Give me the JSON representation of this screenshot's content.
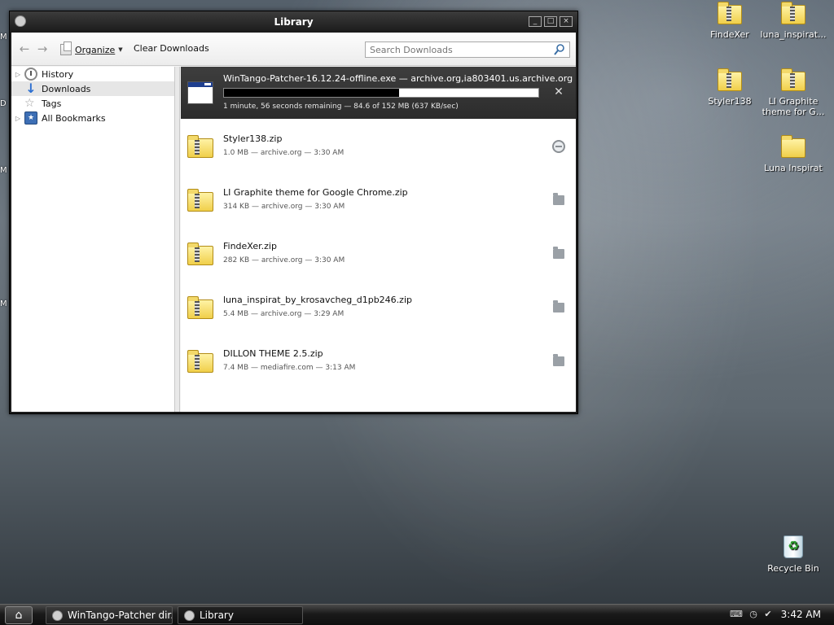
{
  "desktop": {
    "edge_letters": [
      "M",
      "D",
      "M",
      "M"
    ],
    "icons": [
      {
        "label": "FindeXer",
        "kind": "zip"
      },
      {
        "label": "luna_inspirat...",
        "kind": "zip"
      },
      {
        "label": "Styler138",
        "kind": "zip"
      },
      {
        "label": "LI Graphite theme for G...",
        "kind": "zip"
      },
      {
        "label": "Luna Inspirat",
        "kind": "folder"
      },
      {
        "label": "Recycle Bin",
        "kind": "recycle-bin"
      }
    ]
  },
  "window": {
    "title": "Library",
    "controls": {
      "minimize": "_",
      "maximize": "□",
      "close": "×"
    }
  },
  "toolbar": {
    "organize_label": "Organize",
    "clear_label": "Clear Downloads",
    "search_placeholder": "Search Downloads"
  },
  "sidebar": {
    "items": [
      {
        "label": "History",
        "icon": "clock-icon",
        "expandable": true
      },
      {
        "label": "Downloads",
        "icon": "download-icon",
        "expandable": false,
        "selected": true
      },
      {
        "label": "Tags",
        "icon": "tag-icon",
        "expandable": false
      },
      {
        "label": "All Bookmarks",
        "icon": "bookmarks-icon",
        "expandable": true
      }
    ]
  },
  "active_download": {
    "name": "WinTango-Patcher-16.12.24-offline.exe — archive.org,ia803401.us.archive.org",
    "status": "1 minute, 56 seconds remaining — 84.6 of 152 MB (637 KB/sec)",
    "progress": 0.557
  },
  "downloads": [
    {
      "name": "Styler138.zip",
      "meta": "1.0 MB — archive.org — 3:30 AM",
      "action": "retry"
    },
    {
      "name": "LI Graphite theme for Google Chrome.zip",
      "meta": "314 KB — archive.org — 3:30 AM",
      "action": "open-folder"
    },
    {
      "name": "FindeXer.zip",
      "meta": "282 KB — archive.org — 3:30 AM",
      "action": "open-folder"
    },
    {
      "name": "luna_inspirat_by_krosavcheg_d1pb246.zip",
      "meta": "5.4 MB — archive.org — 3:29 AM",
      "action": "open-folder"
    },
    {
      "name": "DILLON THEME 2.5.zip",
      "meta": "7.4 MB — mediafire.com — 3:13 AM",
      "action": "open-folder"
    }
  ],
  "taskbar": {
    "tasks": [
      {
        "label": "WinTango-Patcher dir...",
        "active": false
      },
      {
        "label": "Library",
        "active": true
      }
    ],
    "clock": "3:42 AM"
  }
}
